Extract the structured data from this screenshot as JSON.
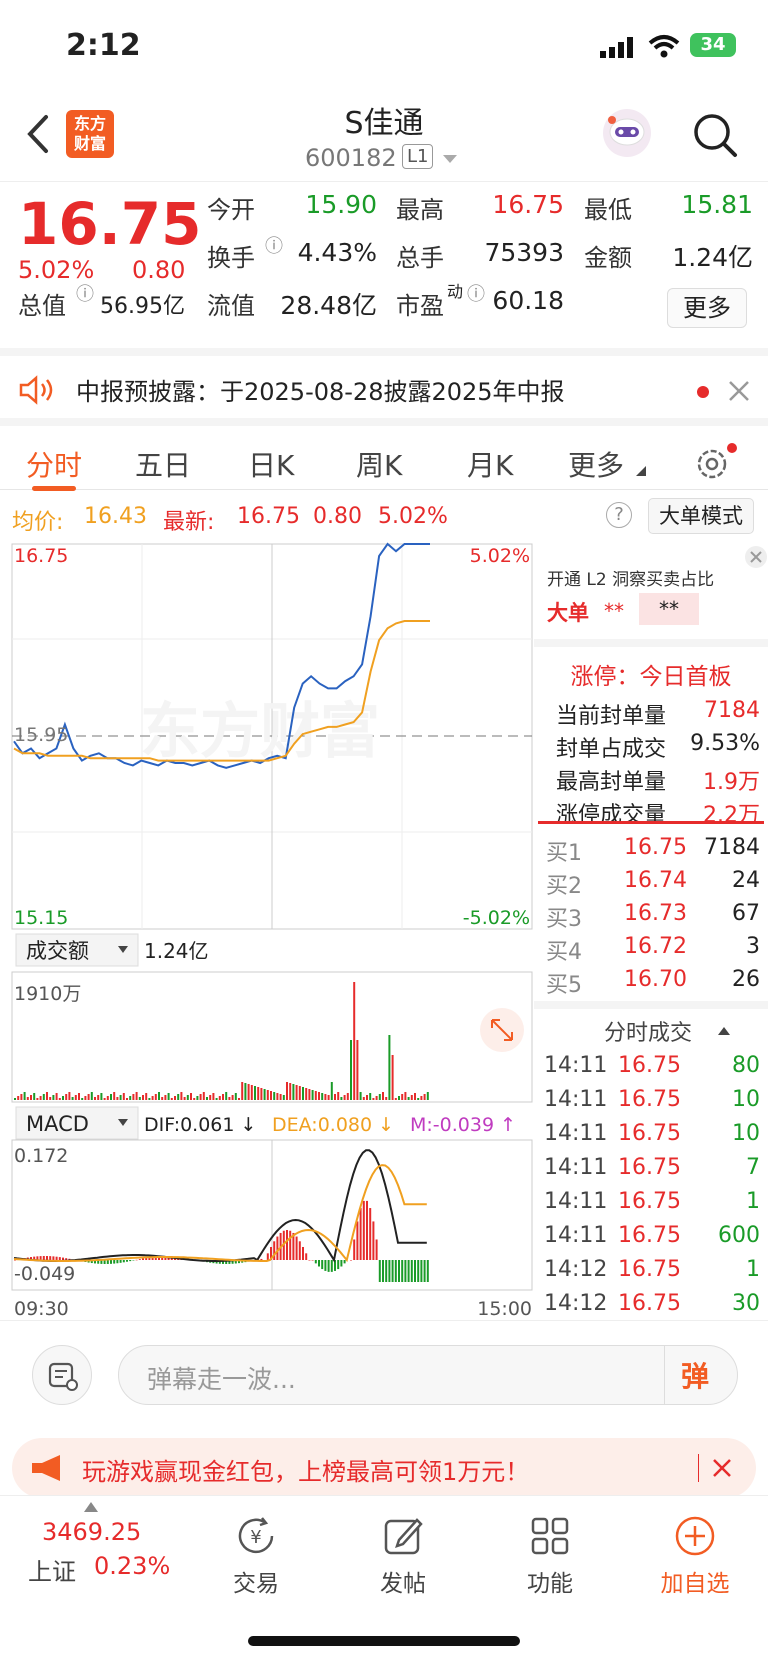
{
  "status_bar": {
    "time": "2:12",
    "battery": "34"
  },
  "header": {
    "stock_name": "S佳通",
    "stock_code": "600182",
    "level": "L1",
    "logo_text_line1": "东方",
    "logo_text_line2": "财富"
  },
  "quote": {
    "price": "16.75",
    "change_pct": "5.02%",
    "change": "0.80",
    "open_label": "今开",
    "open": "15.90",
    "high_label": "最高",
    "high": "16.75",
    "low_label": "最低",
    "low": "15.81",
    "turnover_label": "换手",
    "turnover": "4.43%",
    "volume_label": "总手",
    "volume": "75393",
    "amount_label": "金额",
    "amount": "1.24亿",
    "mktcap_label": "总值",
    "mktcap": "56.95亿",
    "float_label": "流值",
    "float_cap": "28.48亿",
    "pe_label": "市盈",
    "pe_sup": "动",
    "pe": "60.18",
    "more_label": "更多"
  },
  "notice": {
    "text": "中报预披露：于2025-08-28披露2025年中报"
  },
  "tabs": {
    "t1": "分时",
    "t2": "五日",
    "t3": "日K",
    "t4": "周K",
    "t5": "月K",
    "t6": "更多"
  },
  "info_line": {
    "avg_label": "均价:",
    "avg": "16.43",
    "latest_label": "最新:",
    "latest": "16.75",
    "latest_change": "0.80",
    "latest_pct": "5.02%",
    "mode_button": "大单模式"
  },
  "chart_labels": {
    "top_price": "16.75",
    "top_pct": "5.02%",
    "mid_price": "15.95",
    "bottom_price": "15.15",
    "bottom_pct": "-5.02%",
    "vol_selector": "成交额",
    "vol_total": "1.24亿",
    "vol_max": "1910万",
    "macd_selector": "MACD",
    "dif": "DIF:0.061 ↓",
    "dea": "DEA:0.080 ↓",
    "m": "M:-0.039 ↑",
    "macd_top": "0.172",
    "macd_bottom": "-0.049",
    "time_start": "09:30",
    "time_end": "15:00"
  },
  "chart_data": {
    "type": "line",
    "title": "",
    "xlabel": "",
    "ylabel": "",
    "ylim": [
      15.15,
      16.75
    ],
    "prev_close": 15.95,
    "series": [
      {
        "name": "",
        "color": "#2a62c0",
        "values": [
          15.93,
          15.88,
          15.9,
          15.86,
          15.88,
          15.9,
          16.0,
          15.9,
          15.85,
          15.87,
          15.88,
          15.86,
          15.86,
          15.84,
          15.83,
          15.85,
          15.84,
          15.83,
          15.85,
          15.84,
          15.84,
          15.83,
          15.84,
          15.85,
          15.83,
          15.82,
          15.83,
          15.84,
          15.85,
          15.84,
          15.86,
          15.87,
          15.86,
          16.07,
          16.17,
          16.2,
          16.17,
          16.15,
          16.15,
          16.18,
          16.2,
          16.25,
          16.45,
          16.7,
          16.75,
          16.72,
          16.75,
          16.75,
          16.75,
          16.75
        ]
      },
      {
        "name": "",
        "color": "#f0a020",
        "values": [
          15.9,
          15.88,
          15.88,
          15.88,
          15.87,
          15.87,
          15.87,
          15.87,
          15.87,
          15.86,
          15.86,
          15.86,
          15.86,
          15.86,
          15.86,
          15.86,
          15.86,
          15.85,
          15.85,
          15.85,
          15.85,
          15.85,
          15.85,
          15.85,
          15.85,
          15.85,
          15.85,
          15.85,
          15.85,
          15.85,
          15.85,
          15.86,
          15.87,
          15.92,
          15.96,
          15.97,
          15.98,
          15.99,
          15.99,
          16.0,
          16.01,
          16.05,
          16.22,
          16.35,
          16.4,
          16.42,
          16.43,
          16.43,
          16.43,
          16.43
        ]
      }
    ]
  },
  "right_panel": {
    "l2_text": "开通 L2 洞察买卖占比",
    "big_order_label": "大单",
    "big_order_v1": "**",
    "big_order_v2": "**",
    "limit_title": "涨停：今日首板",
    "seal_amount_label": "当前封单量",
    "seal_amount": "7184",
    "seal_ratio_label": "封单占成交",
    "seal_ratio": "9.53%",
    "max_seal_label": "最高封单量",
    "max_seal": "1.9万",
    "limit_volume_label": "涨停成交量",
    "limit_volume": "2.2万",
    "bids": [
      {
        "label": "买1",
        "price": "16.75",
        "vol": "7184"
      },
      {
        "label": "买2",
        "price": "16.74",
        "vol": "24"
      },
      {
        "label": "买3",
        "price": "16.73",
        "vol": "67"
      },
      {
        "label": "买4",
        "price": "16.72",
        "vol": "3"
      },
      {
        "label": "买5",
        "price": "16.70",
        "vol": "26"
      }
    ],
    "trades_title": "分时成交",
    "trades": [
      {
        "time": "14:11",
        "price": "16.75",
        "vol": "80"
      },
      {
        "time": "14:11",
        "price": "16.75",
        "vol": "10"
      },
      {
        "time": "14:11",
        "price": "16.75",
        "vol": "10"
      },
      {
        "time": "14:11",
        "price": "16.75",
        "vol": "7"
      },
      {
        "time": "14:11",
        "price": "16.75",
        "vol": "1"
      },
      {
        "time": "14:11",
        "price": "16.75",
        "vol": "600"
      },
      {
        "time": "14:12",
        "price": "16.75",
        "vol": "1"
      },
      {
        "time": "14:12",
        "price": "16.75",
        "vol": "30"
      }
    ]
  },
  "input": {
    "placeholder": "弹幕走一波...",
    "danmu_btn": "弹"
  },
  "promo": {
    "text": "玩游戏赢现金红包，上榜最高可领1万元！"
  },
  "bottom_nav": {
    "index_value": "3469.25",
    "index_name": "上证",
    "index_pct": "0.23%",
    "trade": "交易",
    "post": "发帖",
    "func": "功能",
    "add": "加自选"
  }
}
